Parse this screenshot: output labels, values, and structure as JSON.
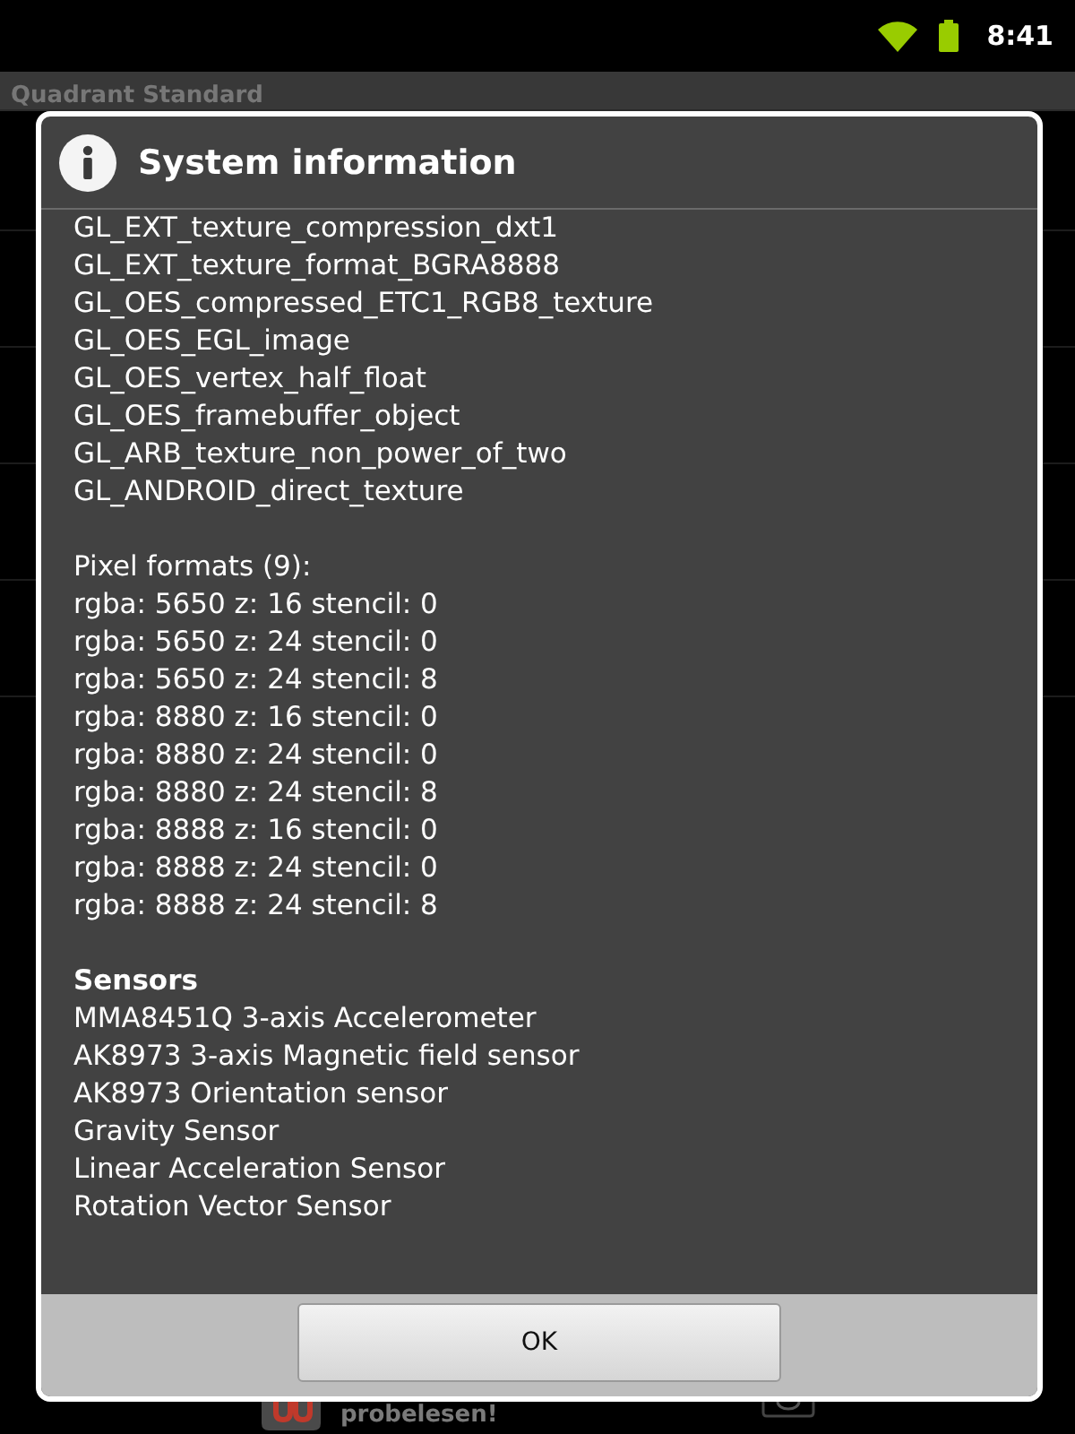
{
  "status_bar": {
    "time": "8:41"
  },
  "app": {
    "title": "Quadrant Standard"
  },
  "ad_banner": {
    "text": "probelesen!"
  },
  "dialog": {
    "title": "System information",
    "sections": [
      {
        "lines": [
          "GL_EXT_texture_compression_dxt1",
          "GL_EXT_texture_format_BGRA8888",
          "GL_OES_compressed_ETC1_RGB8_texture",
          "GL_OES_EGL_image",
          "GL_OES_vertex_half_float",
          "GL_OES_framebuffer_object",
          "GL_ARB_texture_non_power_of_two",
          "GL_ANDROID_direct_texture"
        ]
      },
      {
        "lines": [
          "Pixel formats (9):",
          "rgba: 5650 z: 16 stencil: 0",
          "rgba: 5650 z: 24 stencil: 0",
          "rgba: 5650 z: 24 stencil: 8",
          "rgba: 8880 z: 16 stencil: 0",
          "rgba: 8880 z: 24 stencil: 0",
          "rgba: 8880 z: 24 stencil: 8",
          "rgba: 8888 z: 16 stencil: 0",
          "rgba: 8888 z: 24 stencil: 0",
          "rgba: 8888 z: 24 stencil: 8"
        ]
      },
      {
        "heading": "Sensors",
        "lines": [
          "MMA8451Q 3-axis Accelerometer",
          "AK8973 3-axis Magnetic field sensor",
          "AK8973 Orientation sensor",
          "Gravity Sensor",
          "Linear Acceleration Sensor",
          "Rotation Vector Sensor"
        ]
      }
    ],
    "buttons": [
      "OK"
    ]
  }
}
